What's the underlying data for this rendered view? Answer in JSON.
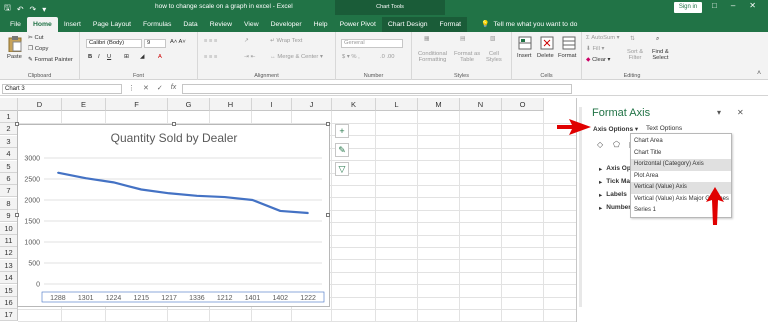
{
  "titlebar": {
    "doc_title": "how to change scale on a graph in excel - Excel",
    "chart_tools": "Chart Tools",
    "sign_in": "Sign in"
  },
  "tabs": [
    "File",
    "Home",
    "Insert",
    "Page Layout",
    "Formulas",
    "Data",
    "Review",
    "View",
    "Developer",
    "Help",
    "Power Pivot",
    "Chart Design",
    "Format"
  ],
  "tell_me": "Tell me what you want to do",
  "ribbon": {
    "paste": "Paste",
    "cut": "Cut",
    "copy": "Copy",
    "format_painter": "Format Painter",
    "clipboard": "Clipboard",
    "font_name": "Calibri (Body)",
    "font_size": "9",
    "font": "Font",
    "wrap_text": "Wrap Text",
    "merge_center": "Merge & Center",
    "alignment": "Alignment",
    "number_format": "General",
    "number": "Number",
    "conditional": "Conditional",
    "conditional2": "Formatting",
    "format_as": "Format as",
    "format_as2": "Table",
    "cell_styles": "Cell",
    "cell_styles2": "Styles",
    "styles": "Styles",
    "insert": "Insert",
    "delete": "Delete",
    "format": "Format",
    "cells": "Cells",
    "autosum": "AutoSum",
    "fill": "Fill",
    "clear": "Clear",
    "sort_filter": "Sort &",
    "sort_filter2": "Filter",
    "find_select": "Find &",
    "find_select2": "Select",
    "editing": "Editing"
  },
  "name_box": "Chart 3",
  "columns": [
    "D",
    "E",
    "F",
    "G",
    "H",
    "I",
    "J",
    "K",
    "L",
    "M",
    "N",
    "O"
  ],
  "rows": [
    "1",
    "2",
    "3",
    "4",
    "5",
    "6",
    "7",
    "8",
    "9",
    "10",
    "11",
    "12",
    "13",
    "14",
    "15",
    "16",
    "17"
  ],
  "chart_data": {
    "type": "line",
    "title": "Quantity Sold by Dealer",
    "categories": [
      "1288",
      "1301",
      "1224",
      "1215",
      "1217",
      "1336",
      "1212",
      "1401",
      "1402",
      "1222"
    ],
    "values": [
      2650,
      2520,
      2420,
      2250,
      2160,
      2100,
      2070,
      2000,
      1740,
      1690
    ],
    "y_ticks": [
      "3000",
      "2500",
      "2000",
      "1500",
      "1000",
      "500",
      "0"
    ],
    "ylim": [
      0,
      3000
    ],
    "grid": true,
    "line_color": "#4472c4"
  },
  "pane": {
    "title": "Format Axis",
    "axis_options": "Axis Options",
    "text_options": "Text Options",
    "sections": [
      "Axis Options",
      "Tick Marks",
      "Labels",
      "Number"
    ],
    "dropdown": [
      "Chart Area",
      "Chart Title",
      "Horizontal (Category) Axis",
      "Plot Area",
      "Vertical (Value) Axis",
      "Vertical (Value) Axis Major Gridlines",
      "Series 1"
    ]
  },
  "colors": {
    "excel_green": "#217346",
    "annotation_red": "#e00000"
  }
}
